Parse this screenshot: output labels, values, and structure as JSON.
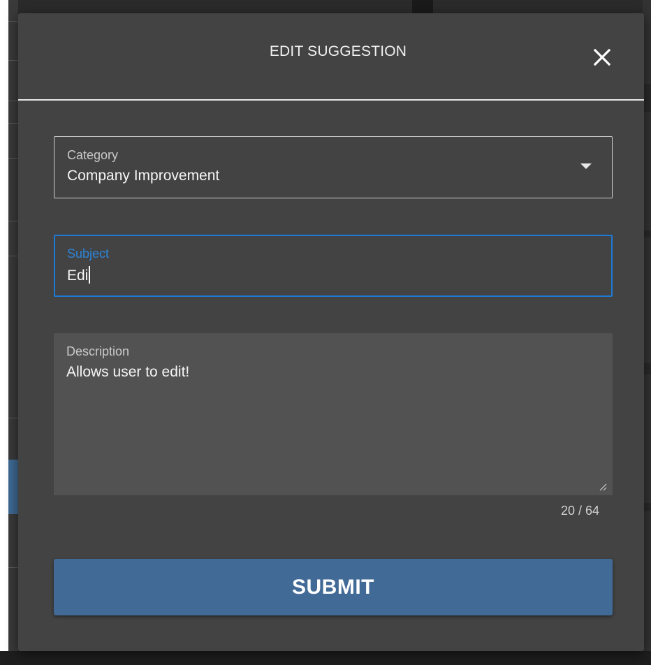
{
  "modal": {
    "title": "EDIT SUGGESTION",
    "close_icon": "close-icon"
  },
  "form": {
    "category": {
      "label": "Category",
      "value": "Company Improvement",
      "icon": "dropdown-arrow-icon"
    },
    "subject": {
      "label": "Subject",
      "value": "Edi"
    },
    "description": {
      "label": "Description",
      "value": "Allows user to edit!",
      "icon": "resize-handle-icon"
    },
    "counter": "20 / 64",
    "submit_label": "SUBMIT"
  },
  "colors": {
    "modal_bg": "#434343",
    "focus_blue": "#1e7ad6",
    "submit_bg": "#426a96"
  }
}
